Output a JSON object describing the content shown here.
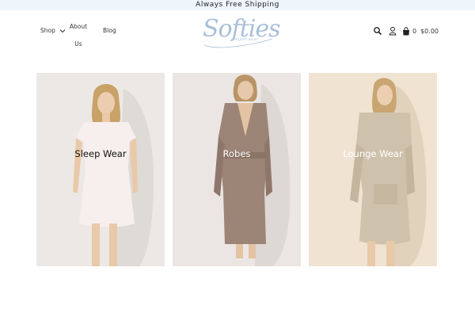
{
  "announcement": "Always Free Shipping",
  "nav": {
    "shop": "Shop",
    "about_line1": "About",
    "about_line2": "Us",
    "blog": "Blog"
  },
  "logo": {
    "script": "Softies",
    "tagline": "comfort wear"
  },
  "cart": {
    "count": "0",
    "total": "$0.00"
  },
  "icons": {
    "search": "search-icon",
    "account": "user-icon",
    "cart": "shopping-bag-icon",
    "shop_dropdown": "chevron-down-icon"
  },
  "categories": [
    {
      "label": "Sleep Wear",
      "bg": "#ece8e5",
      "garment": "#f7eeee"
    },
    {
      "label": "Robes",
      "bg": "#ebe6e3",
      "garment": "#9c8577"
    },
    {
      "label": "Lounge Wear",
      "bg": "#f0e3d2",
      "garment": "#cfc2ac"
    }
  ],
  "colors": {
    "announcement_bg": "#eef5fb",
    "logo": "#a9bfd8"
  }
}
